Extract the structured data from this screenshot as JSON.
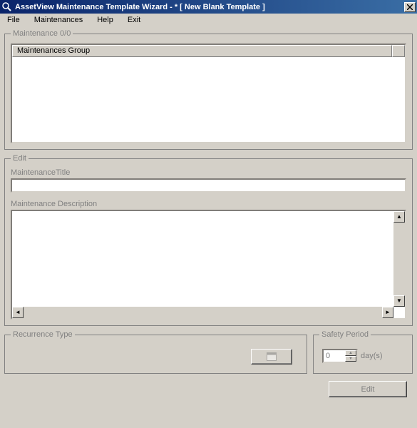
{
  "window": {
    "title": "AssetView Maintenance Template Wizard - * [ New Blank Template ]",
    "close": "×"
  },
  "menu": {
    "file": "File",
    "maint": "Maintenances",
    "help": "Help",
    "exit": "Exit"
  },
  "group_maint": {
    "legend": "Maintenance  0/0",
    "col_group": "Maintenances Group"
  },
  "group_edit": {
    "legend": "Edit",
    "title_label": "MaintenanceTitle",
    "title_value": "",
    "desc_label": "Maintenance Description",
    "desc_value": ""
  },
  "group_recur": {
    "legend": "Recurrence Type"
  },
  "group_safety": {
    "legend": "Safety Period",
    "value": "0",
    "unit": "day(s)"
  },
  "footer": {
    "edit": "Edit"
  }
}
